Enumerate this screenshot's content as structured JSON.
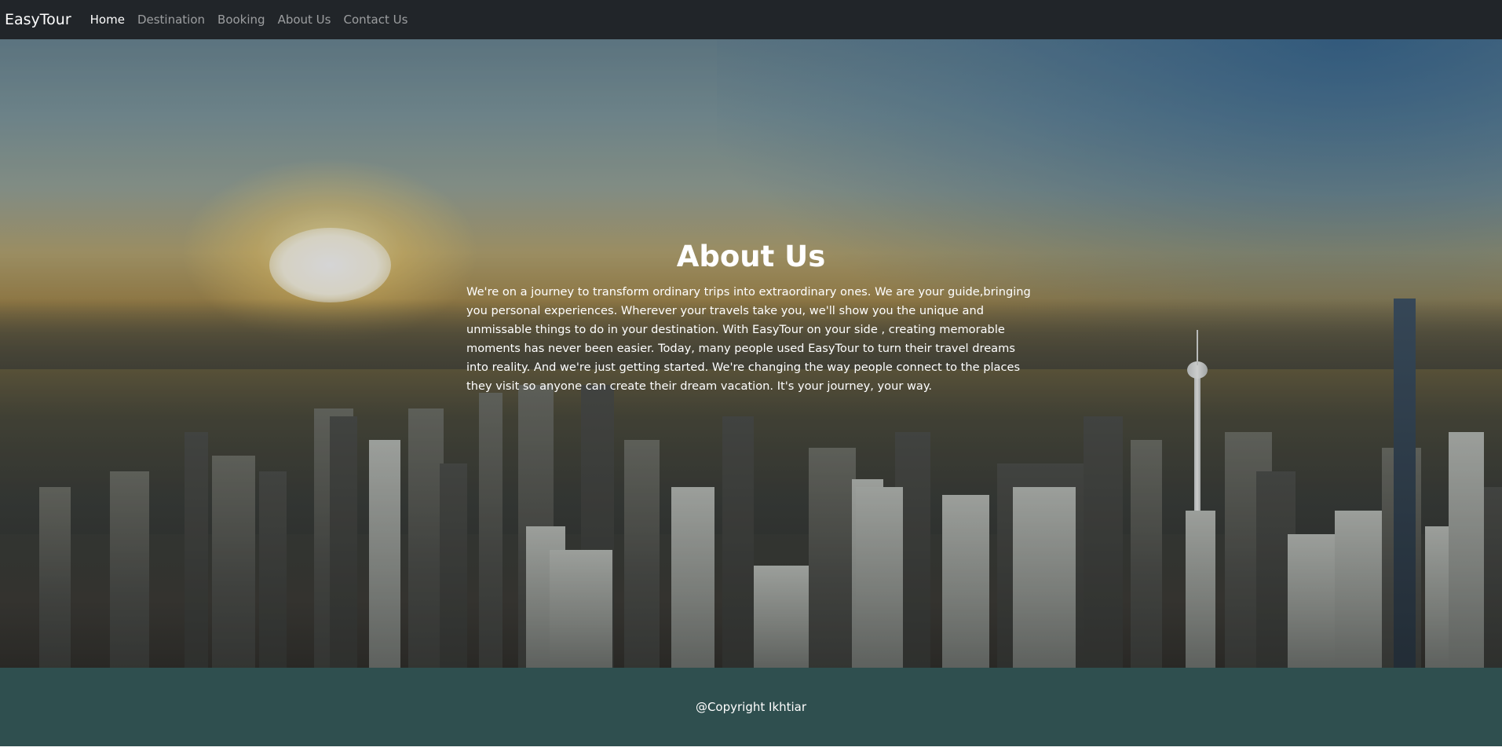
{
  "navbar": {
    "brand": "EasyTour",
    "links": [
      {
        "label": "Home",
        "active": true
      },
      {
        "label": "Destination",
        "active": false
      },
      {
        "label": "Booking",
        "active": false
      },
      {
        "label": "About Us",
        "active": false
      },
      {
        "label": "Contact Us",
        "active": false
      }
    ]
  },
  "hero": {
    "title": "About Us",
    "text": "We're on a journey to transform ordinary trips into extraordinary ones. We are your guide,bringing you personal experiences. Wherever your travels take you, we'll show you the unique and unmissable things to do in your destination. With EasyTour on your side , creating memorable moments has never been easier. Today, many people used EasyTour to turn their travel dreams into reality. And we're just getting started. We're changing the way people connect to the places they visit so anyone can create their dream vacation. It's your journey, your way."
  },
  "footer": {
    "copyright": "@Copyright Ikhtiar"
  },
  "colors": {
    "navbar_bg": "#212529",
    "footer_bg": "#2f4f4f",
    "text": "#ffffff"
  }
}
